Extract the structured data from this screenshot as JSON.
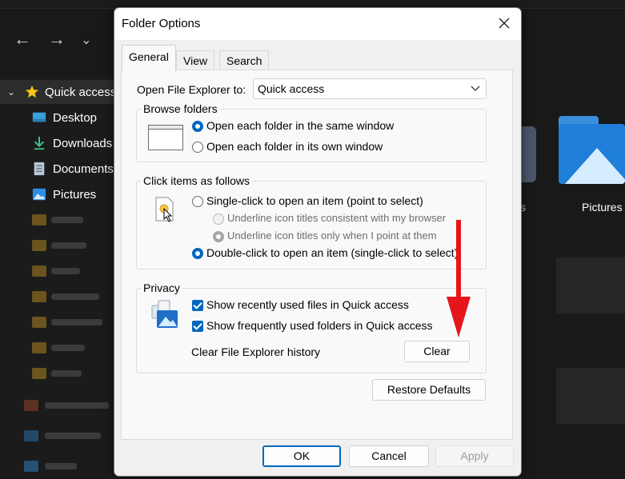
{
  "background": {
    "sidebar": {
      "quick_access": "Quick access",
      "items": [
        "Desktop",
        "Downloads",
        "Documents",
        "Pictures"
      ]
    },
    "content": {
      "pictures_label": "Pictures",
      "partial_label": "s"
    }
  },
  "dialog": {
    "title": "Folder Options",
    "tabs": [
      "General",
      "View",
      "Search"
    ],
    "open_to": {
      "label": "Open File Explorer to:",
      "value": "Quick access"
    },
    "browse": {
      "title": "Browse folders",
      "options": [
        "Open each folder in the same window",
        "Open each folder in its own window"
      ]
    },
    "click": {
      "title": "Click items as follows",
      "single": "Single-click to open an item (point to select)",
      "sub_options": [
        "Underline icon titles consistent with my browser",
        "Underline icon titles only when I point at them"
      ],
      "double": "Double-click to open an item (single-click to select)"
    },
    "privacy": {
      "title": "Privacy",
      "checks": [
        "Show recently used files in Quick access",
        "Show frequently used folders in Quick access"
      ],
      "clear_label": "Clear File Explorer history",
      "clear_button": "Clear"
    },
    "restore_button": "Restore Defaults",
    "footer": {
      "ok": "OK",
      "cancel": "Cancel",
      "apply": "Apply"
    }
  },
  "colors": {
    "accent": "#0067c0",
    "annotation": "#e5161b"
  }
}
